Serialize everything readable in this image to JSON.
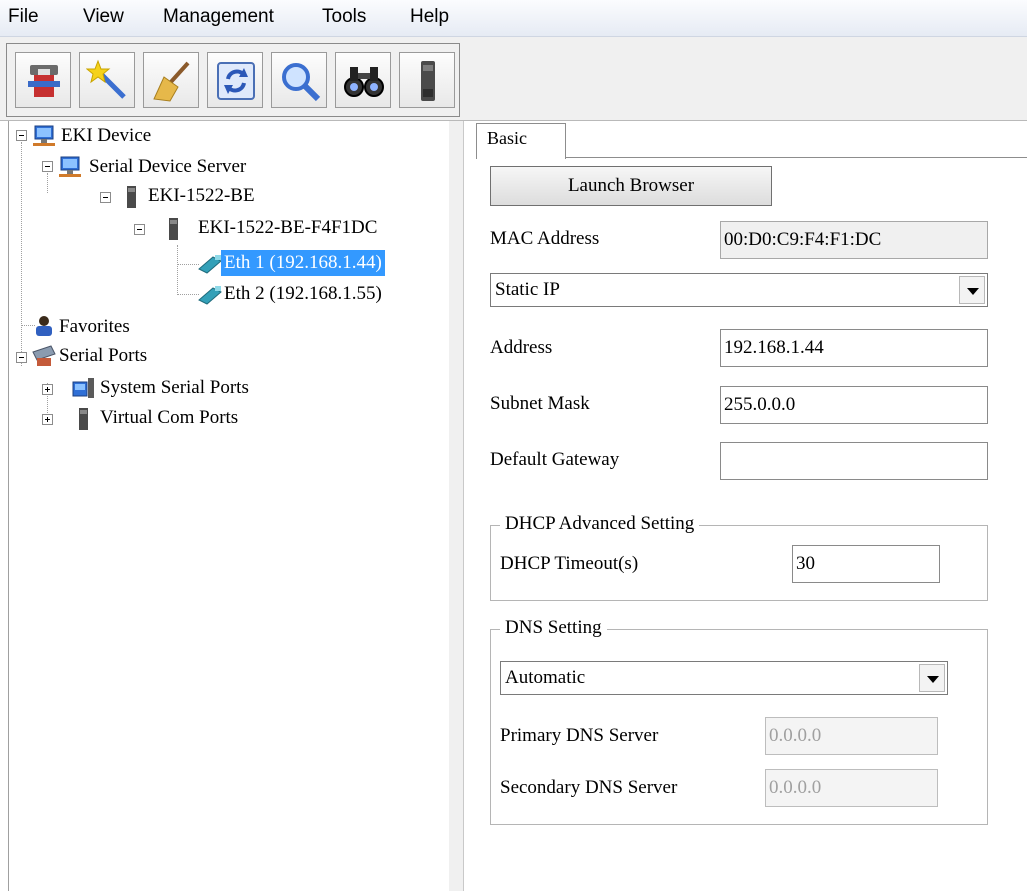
{
  "menu": [
    "File",
    "View",
    "Management",
    "Tools",
    "Help"
  ],
  "toolbar": {
    "buttons": [
      "add-device-icon",
      "wizard-icon",
      "clean-icon",
      "refresh-icon",
      "search-icon",
      "find-icon",
      "device-icon"
    ]
  },
  "tree": {
    "root": "EKI Device",
    "serial_device_server": "Serial Device Server",
    "device": "EKI-1522-BE",
    "device_instance": "EKI-1522-BE-F4F1DC",
    "eth1": "Eth 1 (192.168.1.44)",
    "eth2": "Eth 2 (192.168.1.55)",
    "favorites": "Favorites",
    "serial_ports": "Serial Ports",
    "system_serial_ports": "System Serial Ports",
    "virtual_com_ports": "Virtual Com Ports"
  },
  "panel": {
    "tab": "Basic",
    "launch_browser": "Launch Browser",
    "mac_label": "MAC Address",
    "mac_value": "00:D0:C9:F4:F1:DC",
    "ip_mode": "Static IP",
    "address_label": "Address",
    "address_value": "192.168.1.44",
    "subnet_label": "Subnet Mask",
    "subnet_value": "255.0.0.0",
    "gateway_label": "Default Gateway",
    "gateway_value": "",
    "dhcp_group": "DHCP Advanced Setting",
    "dhcp_timeout_label": "DHCP Timeout(s)",
    "dhcp_timeout_value": "30",
    "dns_group": "DNS Setting",
    "dns_mode": "Automatic",
    "primary_dns_label": "Primary DNS Server",
    "primary_dns_value": "0.0.0.0",
    "secondary_dns_label": "Secondary DNS Server",
    "secondary_dns_value": "0.0.0.0"
  },
  "colors": {
    "selection": "#3399ff",
    "menubar": "#e6ebf4"
  }
}
